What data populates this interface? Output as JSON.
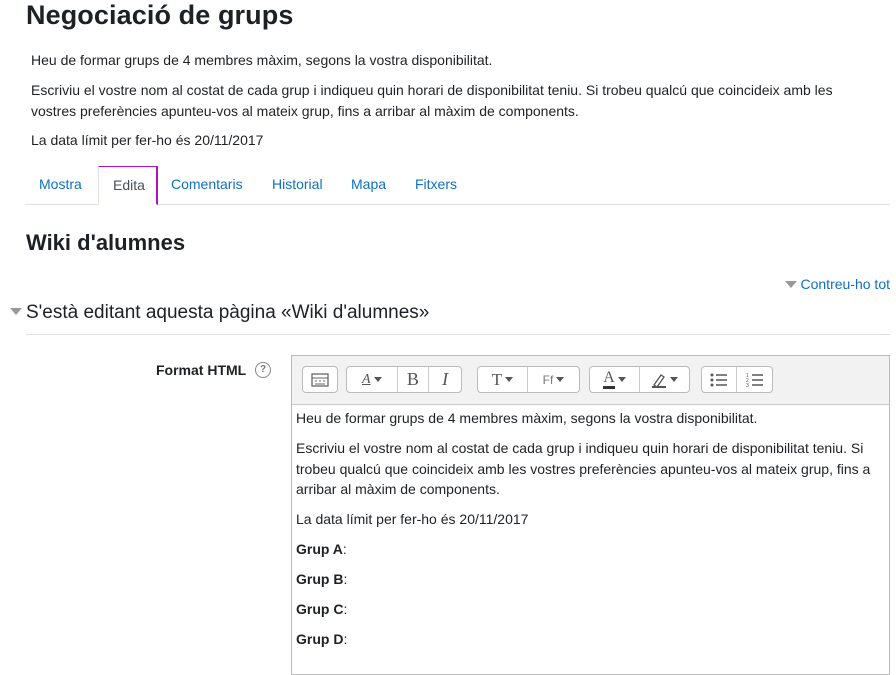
{
  "page": {
    "title": "Negociació de grups",
    "intro": [
      "Heu de formar grups de 4 membres màxim, segons la vostra disponibilitat.",
      "Escriviu el vostre nom al costat de cada grup i indiqueu quin horari de disponibilitat teniu. Si trobeu qualcú que coincideix amb les vostres preferències apunteu-vos al mateix grup, fins a arribar al màxim de components.",
      "La data límit per fer-ho és 20/11/2017"
    ]
  },
  "tabs": [
    {
      "label": "Mostra",
      "active": false
    },
    {
      "label": "Edita",
      "active": true
    },
    {
      "label": "Comentaris",
      "active": false
    },
    {
      "label": "Historial",
      "active": false
    },
    {
      "label": "Mapa",
      "active": false
    },
    {
      "label": "Fitxers",
      "active": false
    }
  ],
  "wiki": {
    "title": "Wiki d'alumnes",
    "collapse_all": "Contreu-ho tot",
    "legend": "S'està editant aquesta pàgina «Wiki d'alumnes»"
  },
  "form": {
    "format_label": "Format HTML",
    "help_icon": "question-circle-icon"
  },
  "editor": {
    "toolbar": {
      "bold": "B",
      "italic": "I",
      "font_family": "Ff"
    },
    "content": [
      "Heu de formar grups de 4 membres màxim, segons la vostra disponibilitat.",
      "Escriviu el vostre nom al costat de cada grup i indiqueu quin horari de disponibilitat teniu. Si trobeu qualcú que coincideix amb les vostres preferències apunteu-vos al mateix grup, fins a arribar al màxim de components.",
      "La data límit per fer-ho és 20/11/2017"
    ],
    "groups": [
      {
        "name": "Grup A",
        "sep": ":"
      },
      {
        "name": "Grup B",
        "sep": ":"
      },
      {
        "name": "Grup C",
        "sep": ":"
      },
      {
        "name": "Grup D",
        "sep": ":"
      }
    ]
  },
  "colors": {
    "link": "#0f6fc5",
    "active_tab_accent": "#b110c6",
    "text": "#1d2125"
  }
}
